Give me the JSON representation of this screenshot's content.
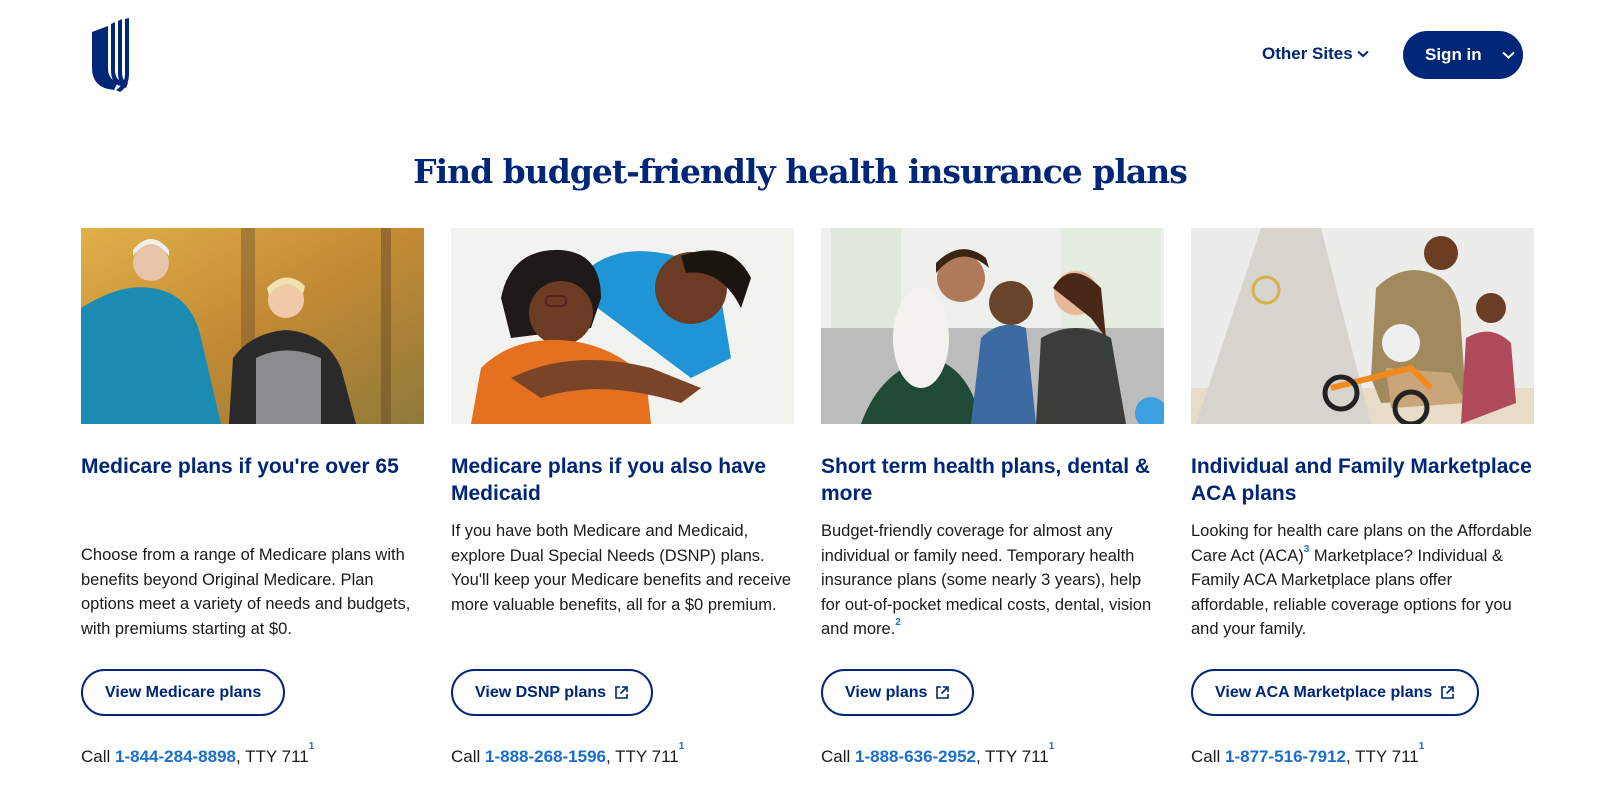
{
  "header": {
    "logo_alt": "UnitedHealthcare logo",
    "other_sites_label": "Other Sites",
    "sign_in_label": "Sign in",
    "brand_color": "#002677"
  },
  "main": {
    "title": "Find budget-friendly health insurance plans",
    "link_color": "#196ecf",
    "cards": [
      {
        "image": "older-couple-jogging-photo",
        "title": "Medicare plans if you're over 65",
        "body": "Choose from a range of  Medicare plans with benefits beyond Original Medicare. Plan options meet a variety of needs and budgets, with premiums starting at $0.",
        "body_sup": "",
        "button_label": "View Medicare plans",
        "button_external": false,
        "call_prefix": "Call ",
        "phone": "1-844-284-8898",
        "call_suffix": ", TTY 711",
        "footnote": "1"
      },
      {
        "image": "nurse-hugging-patient-photo",
        "title": "Medicare plans if you also have Medicaid",
        "body": "If you have both Medicare and Medicaid, explore Dual Special Needs (DSNP) plans. You'll keep your Medicare benefits and receive more valuable benefits, all for a $0 premium.",
        "body_sup": "",
        "button_label": "View DSNP plans",
        "button_external": true,
        "call_prefix": "Call ",
        "phone": "1-888-268-1596",
        "call_suffix": ", TTY 711",
        "footnote": "1"
      },
      {
        "image": "family-on-couch-with-dog-photo",
        "title": "Short term health plans, dental & more",
        "body": "Budget-friendly coverage for almost any individual or family need. Temporary health insurance plans (some nearly 3 years), help for out-of-pocket medical costs, dental, vision and more.",
        "body_sup": "2",
        "button_label": "View plans",
        "button_external": true,
        "call_prefix": "Call ",
        "phone": "1-888-636-2952",
        "call_suffix": ", TTY 711",
        "footnote": "1"
      },
      {
        "image": "father-child-bike-photo",
        "title": "Individual and Family Marketplace ACA plans",
        "body_part1": "Looking for health care plans on the Affordable Care Act (ACA)",
        "body_sup": "3",
        "body_part2": " Marketplace? Individual & Family ACA Marketplace plans offer affordable, reliable coverage options for you and your family.",
        "button_label": "View ACA Marketplace plans",
        "button_external": true,
        "call_prefix": "Call ",
        "phone": "1-877-516-7912",
        "call_suffix": ", TTY 711",
        "footnote": "1"
      }
    ]
  }
}
